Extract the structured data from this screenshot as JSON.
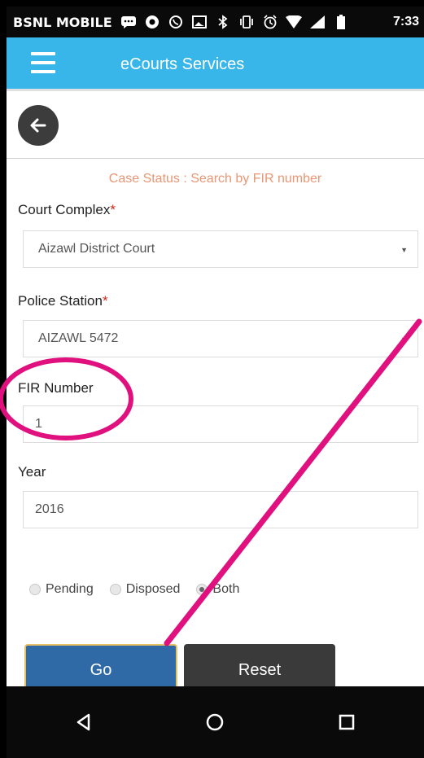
{
  "status_bar": {
    "carrier": "BSNL MOBILE",
    "time": "7:33",
    "icons": [
      "chat-icon",
      "record-icon",
      "whatsapp-icon",
      "gallery-icon",
      "bluetooth-icon",
      "vibrate-icon",
      "alarm-icon",
      "wifi-icon",
      "signal-icon",
      "battery-icon"
    ]
  },
  "app_bar": {
    "title": "eCourts Services",
    "menu_icon": "menu-icon",
    "background": "#38b6ea"
  },
  "page": {
    "back_icon": "arrow-left-icon",
    "search_title": "Case Status : Search by FIR number"
  },
  "form": {
    "court_complex": {
      "label": "Court Complex",
      "required_mark": "*",
      "value": "Aizawl District Court"
    },
    "police_station": {
      "label": "Police Station",
      "required_mark": "*",
      "value": "AIZAWL 5472"
    },
    "fir_number": {
      "label": "FIR Number",
      "value": "1"
    },
    "year": {
      "label": "Year",
      "value": "2016"
    },
    "status_options": [
      {
        "label": "Pending",
        "selected": false
      },
      {
        "label": "Disposed",
        "selected": false
      },
      {
        "label": "Both",
        "selected": true
      }
    ]
  },
  "buttons": {
    "go": "Go",
    "reset": "Reset"
  },
  "nav_bar": {
    "back": "triangle-back-icon",
    "home": "circle-home-icon",
    "recents": "square-recents-icon"
  },
  "colors": {
    "title_accent": "#e89674",
    "go_button": "#2f6aa6",
    "reset_button": "#3a3a3a",
    "annotation": "#e0117f"
  }
}
